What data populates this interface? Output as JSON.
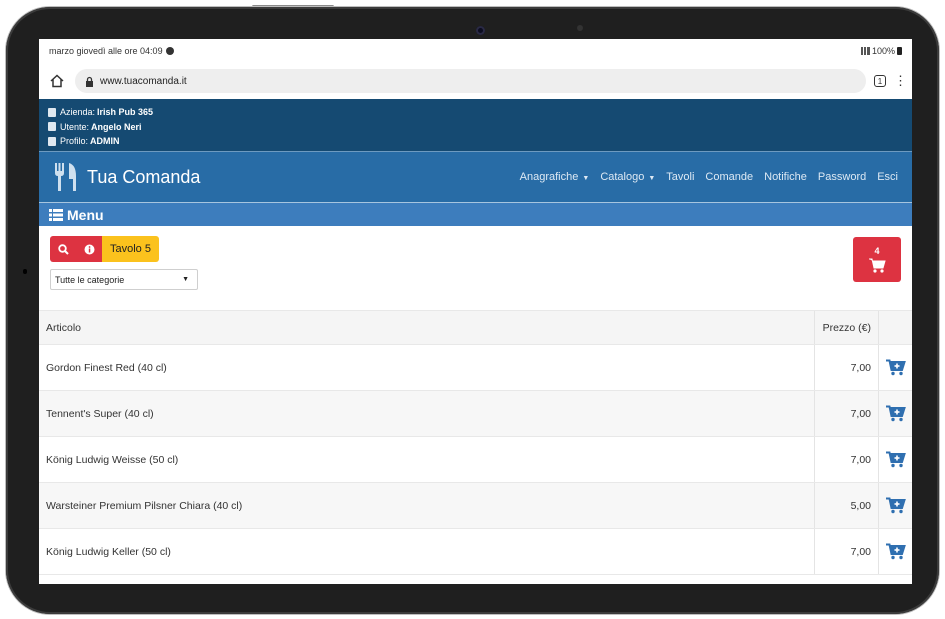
{
  "status_bar": {
    "time_text": "marzo giovedì alle ore 04:09",
    "battery": "100%"
  },
  "browser": {
    "url": "www.tuacomanda.it",
    "tab_count": "1"
  },
  "user_info": {
    "azienda_label": "Azienda:",
    "azienda_value": "Irish Pub 365",
    "utente_label": "Utente:",
    "utente_value": "Angelo Neri",
    "profilo_label": "Profilo:",
    "profilo_value": "ADMIN"
  },
  "navbar": {
    "brand": "Tua Comanda",
    "links": [
      {
        "label": "Anagrafiche",
        "dropdown": true
      },
      {
        "label": "Catalogo",
        "dropdown": true
      },
      {
        "label": "Tavoli",
        "dropdown": false
      },
      {
        "label": "Comande",
        "dropdown": false
      },
      {
        "label": "Notifiche",
        "dropdown": false
      },
      {
        "label": "Password",
        "dropdown": false
      },
      {
        "label": "Esci",
        "dropdown": false
      }
    ]
  },
  "menu": {
    "title": "Menu"
  },
  "toolbar": {
    "table_label": "Tavolo 5",
    "category_select": "Tutte le categorie",
    "cart_count": "4"
  },
  "table": {
    "headers": {
      "article": "Articolo",
      "price": "Prezzo (€)"
    },
    "rows": [
      {
        "name": "Gordon Finest Red (40 cl)",
        "price": "7,00"
      },
      {
        "name": "Tennent's Super (40 cl)",
        "price": "7,00"
      },
      {
        "name": "König Ludwig Weisse (50 cl)",
        "price": "7,00"
      },
      {
        "name": "Warsteiner Premium Pilsner Chiara (40 cl)",
        "price": "5,00"
      },
      {
        "name": "König Ludwig Keller (50 cl)",
        "price": "7,00"
      }
    ]
  },
  "colors": {
    "userbar": "#154a72",
    "navbar": "#286ca6",
    "menubar": "#3d7dbd",
    "danger": "#dd3341",
    "warning": "#fbc21d",
    "cart_add": "#2f6fb0"
  },
  "icons": [
    "home-icon",
    "lock-icon",
    "tabs-icon",
    "kebab-menu-icon",
    "building-icon",
    "user-icon",
    "user-lock-icon",
    "fork-knife-logo-icon",
    "list-icon",
    "search-icon",
    "info-icon",
    "cart-icon",
    "cart-plus-icon"
  ]
}
